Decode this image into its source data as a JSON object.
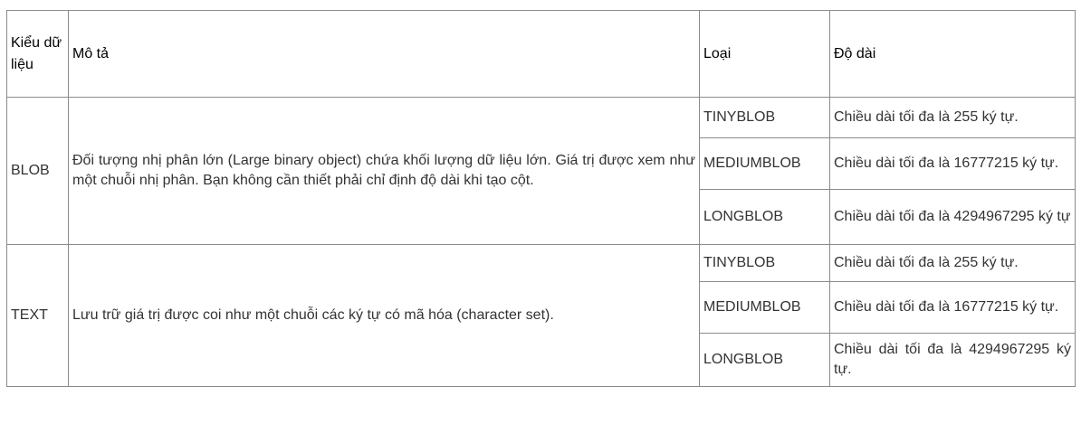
{
  "table": {
    "headers": {
      "kieu": "Kiểu dữ liệu",
      "mo_ta": "Mô tả",
      "loai": "Loại",
      "do_dai": "Độ dài"
    },
    "groups": [
      {
        "kieu": "BLOB",
        "mo_ta": "Đối tượng nhị phân lớn (Large binary object) chứa khối lượng dữ liệu lớn. Giá trị được xem như một chuỗi nhị phân. Bạn không cần thiết phải chỉ định độ dài khi tạo cột.",
        "rows": [
          {
            "loai": "TINYBLOB",
            "do_dai": "Chiều dài tối đa là 255 ký tự."
          },
          {
            "loai": "MEDIUMBLOB",
            "do_dai": "Chiều dài tối đa là 16777215 ký tự."
          },
          {
            "loai": "LONGBLOB",
            "do_dai": "Chiều dài tối đa là 4294967295 ký tự"
          }
        ]
      },
      {
        "kieu": "TEXT",
        "mo_ta": "Lưu trữ giá trị được coi như một chuỗi các ký tự có mã hóa (character set).",
        "rows": [
          {
            "loai": "TINYBLOB",
            "do_dai": "Chiều dài tối đa là 255 ký tự."
          },
          {
            "loai": "MEDIUMBLOB",
            "do_dai": "Chiều dài tối đa là 16777215 ký tự."
          },
          {
            "loai": "LONGBLOB",
            "do_dai": "Chiều dài tối đa là 4294967295 ký tự."
          }
        ]
      }
    ]
  }
}
